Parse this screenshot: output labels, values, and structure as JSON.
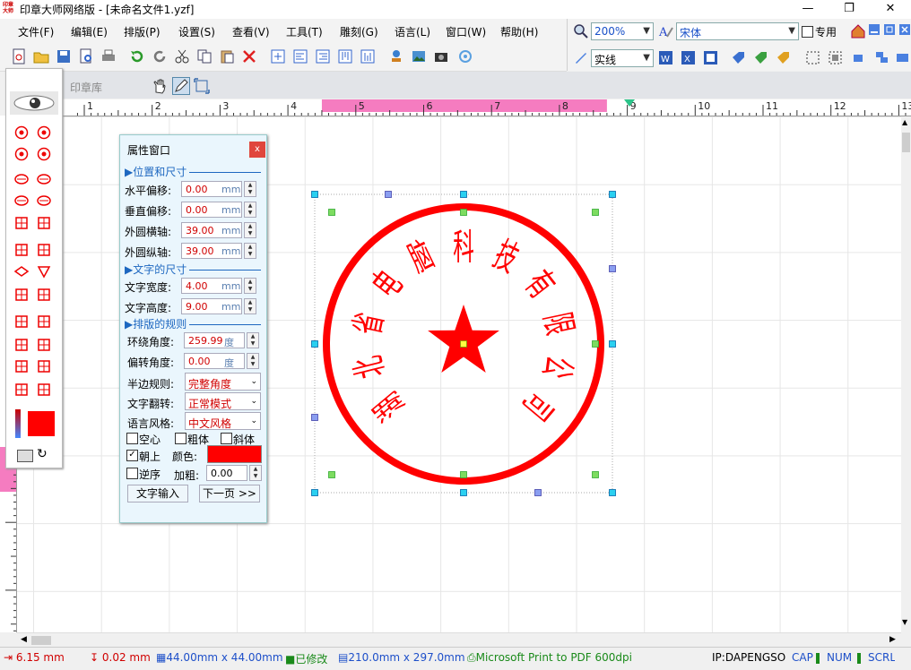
{
  "window": {
    "title": "印章大师网络版 - [未命名文件1.yzf]",
    "app_icon_text": "印章大师"
  },
  "menus": [
    "文件(F)",
    "编辑(E)",
    "排版(P)",
    "设置(S)",
    "查看(V)",
    "工具(T)",
    "雕刻(G)",
    "语言(L)",
    "窗口(W)",
    "帮助(H)"
  ],
  "right_toolbar": {
    "zoom": "200%",
    "font": "宋体",
    "dedicated_label": "专用",
    "line_style": "实线"
  },
  "tabs": {
    "stamp_library": "印章库"
  },
  "ruler": {
    "ticks": [
      "1",
      "2",
      "3",
      "4",
      "5",
      "6",
      "7",
      "8",
      "9",
      "10",
      "11",
      "12",
      "13"
    ],
    "highlight_range": [
      4.5,
      8.7
    ]
  },
  "properties": {
    "title": "属性窗口",
    "close": "x",
    "section_position": "▶位置和尺寸",
    "section_text_size": "▶文字的尺寸",
    "section_layout": "▶排版的规则",
    "fields": {
      "h_offset": {
        "label": "水平偏移:",
        "value": "0.00",
        "unit": "mm"
      },
      "v_offset": {
        "label": "垂直偏移:",
        "value": "0.00",
        "unit": "mm"
      },
      "outer_h": {
        "label": "外圆横轴:",
        "value": "39.00",
        "unit": "mm"
      },
      "outer_v": {
        "label": "外圆纵轴:",
        "value": "39.00",
        "unit": "mm"
      },
      "text_w": {
        "label": "文字宽度:",
        "value": "4.00",
        "unit": "mm"
      },
      "text_h": {
        "label": "文字高度:",
        "value": "9.00",
        "unit": "mm"
      },
      "wrap_angle": {
        "label": "环绕角度:",
        "value": "259.99",
        "unit": "度"
      },
      "rotate_angle": {
        "label": "偏转角度:",
        "value": "0.00",
        "unit": "度"
      }
    },
    "dropdowns": {
      "half_rule": {
        "label": "半边规则:",
        "value": "完整角度"
      },
      "flip": {
        "label": "文字翻转:",
        "value": "正常模式"
      },
      "lang_style": {
        "label": "语言风格:",
        "value": "中文风格"
      }
    },
    "checks": {
      "hollow": "空心",
      "bold": "粗体",
      "italic": "斜体",
      "up": "朝上",
      "reverse": "逆序"
    },
    "color_label": "颜色:",
    "color": "#ff0000",
    "thicken_label": "加粗:",
    "thicken_value": "0.00",
    "btn_text_input": "文字输入",
    "btn_next": "下一页 >>"
  },
  "seal": {
    "text": "湖北省电脑科技有限公司",
    "color": "#ff0000"
  },
  "status": {
    "h_pos": "6.15 mm",
    "v_pos": "0.02 mm",
    "size": "44.00mm x 44.00mm",
    "modified": "已修改",
    "paper": "210.0mm x 297.0mm",
    "printer": "Microsoft Print to PDF 600dpi",
    "ip": "IP:DAPENGSO",
    "cap": "CAP",
    "num": "NUM",
    "scrl": "SCRL"
  }
}
